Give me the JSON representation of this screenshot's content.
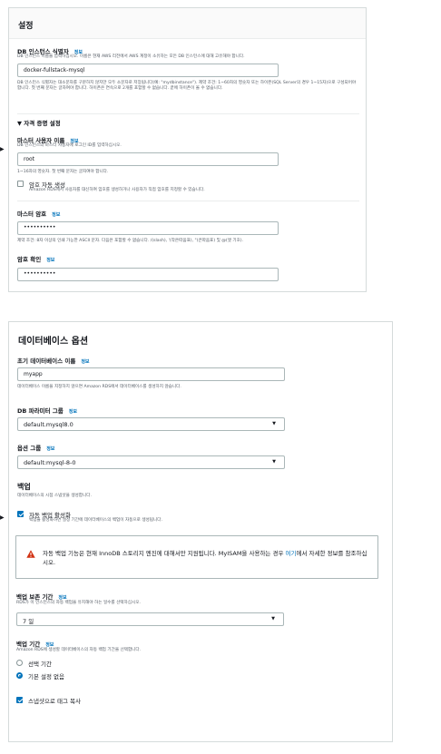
{
  "settings": {
    "title": "설정",
    "db_identifier": {
      "label": "DB 인스턴스 식별자",
      "info": "정보",
      "desc": "DB 인스턴스 이름을 입력하십시오. 이름은 현재 AWS 리전에서 AWS 계정이 소유하는 모든 DB 인스턴스에 대해 고유해야 합니다.",
      "value": "docker-fullstack-mysql",
      "constraint": "DB 인스턴스 식별자는 대소문자를 구분하지 않지만 모두 소문자로 저장됩니다(예: \"mydbinstance\"). 제약 조건: 1~60자의 영숫자 또는 하이픈(SQL Server의 경우 1~15자)으로 구성되어야 합니다. 첫 번째 문자는 글자여야 합니다. 하이픈은 연속으로 2개를 포함할 수 없습니다. 끝에 하이픈이 올 수 없습니다."
    },
    "credentials_toggle": "▼ 자격 증명 설정",
    "master_username": {
      "label": "마스터 사용자 이름",
      "info": "정보",
      "desc": "DB 인스턴스의 마스터 사용자에 로그인 ID를 입력하십시오.",
      "value": "root",
      "constraint": "1~16자의 영숫자. 첫 번째 문자는 글자여야 합니다."
    },
    "auto_password": {
      "label": "암호 자동 생성",
      "desc": "Amazon RDS에서 사용자를 대신하여 암호를 생성하거나 사용자가 직접 암호를 지정할 수 있습니다.",
      "checked": false
    },
    "master_password": {
      "label": "마스터 암호",
      "info": "정보",
      "value": "••••••••••",
      "constraint": "제약 조건: 8자 이상의 인쇄 가능한 ASCII 문자. 다음은 포함할 수 없습니다. /(slash), '(작은따옴표), \"(큰따옴표) 및 @(앳 기호)."
    },
    "confirm_password": {
      "label": "암호 확인",
      "info": "정보",
      "value": "••••••••••"
    }
  },
  "db_options": {
    "title": "데이터베이스 옵션",
    "initial_db": {
      "label": "초기 데이터베이스 이름",
      "info": "정보",
      "value": "myapp",
      "desc": "데이터베이스 이름을 지정하지 않으면 Amazon RDS에서 데이터베이스를 생성하지 않습니다."
    },
    "param_group": {
      "label": "DB 파라미터 그룹",
      "info": "정보",
      "value": "default.mysql8.0"
    },
    "option_group": {
      "label": "옵션 그룹",
      "info": "정보",
      "value": "default:mysql-8-0"
    },
    "backup": {
      "title": "백업",
      "desc": "데이터베이스의 시점 스냅샷을 생성합니다.",
      "auto_backup_label": "자동 백업 활성화",
      "auto_backup_desc": "백업을 활성화하면 설정 기간에 데이터베이스의 백업이 자동으로 생성됩니다.",
      "auto_backup_checked": true,
      "alert_text": "자동 백업 기능은 현재 InnoDB 스토리지 엔진에 대해서만 지원됩니다. MyISAM을 사용하는 경우 ",
      "alert_link": "여기",
      "alert_text_after": "에서 자세한 정보를 참조하십시오."
    },
    "retention": {
      "label": "백업 보존 기간",
      "info": "정보",
      "desc": "RDS가 이 인스턴스의 자동 백업을 유지해야 하는 일수를 선택하십시오.",
      "value": "7 일"
    },
    "backup_window": {
      "label": "백업 기간",
      "info": "정보",
      "desc": "Amazon RDS에 생성할 데이터베이스의 자동 백업 기간을 선택합니다.",
      "options": [
        "선택 기간",
        "기본 설정 없음"
      ],
      "selected": 1
    },
    "copy_tags": {
      "label": "스냅샷으로 태그 복사",
      "checked": true
    }
  },
  "colors": {
    "accent": "#0073bb",
    "border": "#aab7b8",
    "warning": "#d13212"
  },
  "icons": [
    "caret-down-icon",
    "warning-icon",
    "arrow-pointer-icon"
  ]
}
